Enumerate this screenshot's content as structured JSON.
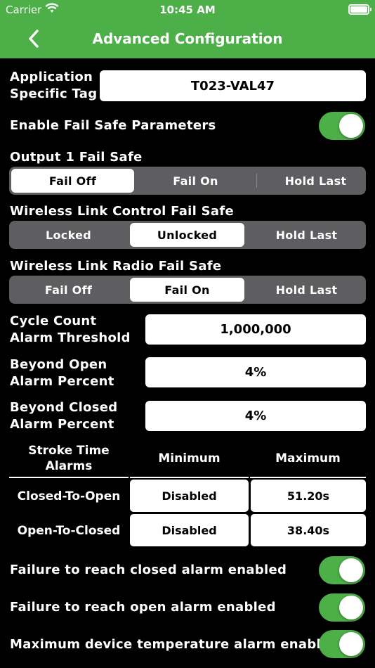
{
  "status": {
    "carrier": "Carrier",
    "time": "10:45 AM"
  },
  "nav": {
    "title": "Advanced Configuration"
  },
  "app_tag": {
    "label_line1": "Application",
    "label_line2": "Specific Tag",
    "value": "T023-VAL47"
  },
  "fail_safe_params": {
    "label": "Enable Fail Safe Parameters",
    "enabled": true
  },
  "output1": {
    "label": "Output 1 Fail Safe",
    "options": [
      "Fail Off",
      "Fail On",
      "Hold Last"
    ],
    "selected": "Fail Off"
  },
  "wl_control": {
    "label": "Wireless Link Control Fail Safe",
    "options": [
      "Locked",
      "Unlocked",
      "Hold Last"
    ],
    "selected": "Unlocked"
  },
  "wl_radio": {
    "label": "Wireless Link Radio Fail Safe",
    "options": [
      "Fail Off",
      "Fail On",
      "Hold Last"
    ],
    "selected": "Fail On"
  },
  "cycle_count": {
    "label_line1": "Cycle Count",
    "label_line2": "Alarm Threshold",
    "value": "1,000,000"
  },
  "beyond_open": {
    "label_line1": "Beyond Open",
    "label_line2": "Alarm Percent",
    "value": "4%"
  },
  "beyond_closed": {
    "label_line1": "Beyond Closed",
    "label_line2": "Alarm Percent",
    "value": "4%"
  },
  "stroke_table": {
    "header_line1": "Stroke Time",
    "header_line2": "Alarms",
    "col_min": "Minimum",
    "col_max": "Maximum",
    "rows": [
      {
        "label": "Closed-To-Open",
        "min": "Disabled",
        "max": "51.20s"
      },
      {
        "label": "Open-To-Closed",
        "min": "Disabled",
        "max": "38.40s"
      }
    ]
  },
  "alarms": [
    {
      "label": "Failure to reach closed alarm enabled",
      "enabled": true
    },
    {
      "label": "Failure to reach open alarm enabled",
      "enabled": true
    },
    {
      "label": "Maximum device temperature alarm enabled",
      "enabled": true
    }
  ],
  "colors": {
    "accent": "#4caf47",
    "background": "#000000",
    "segment_bg": "#5e5e60"
  }
}
